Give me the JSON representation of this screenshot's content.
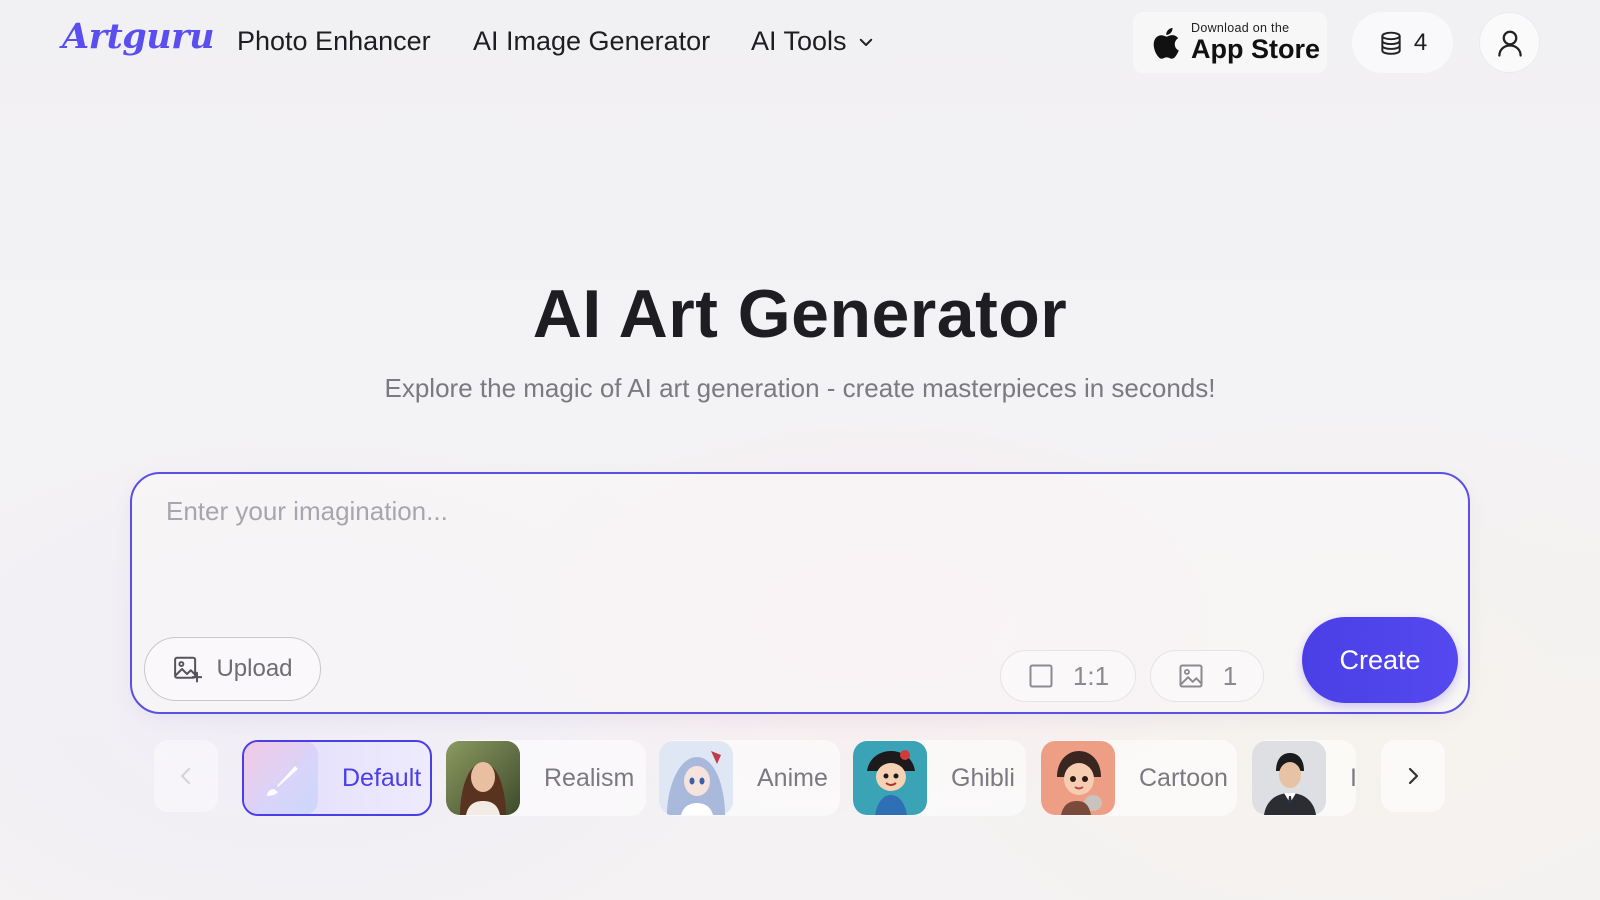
{
  "header": {
    "logo": "Artguru",
    "nav": {
      "photo_enhancer": "Photo Enhancer",
      "ai_image_generator": "AI Image Generator",
      "ai_tools": "AI Tools"
    },
    "app_store": {
      "small": "Download on the",
      "big": "App Store"
    },
    "credits": "4"
  },
  "hero": {
    "title": "AI Art Generator",
    "subtitle": "Explore the magic of AI art generation - create masterpieces in seconds!"
  },
  "prompt": {
    "placeholder": "Enter your imagination...",
    "upload_label": "Upload",
    "aspect_ratio": "1:1",
    "image_count": "1",
    "create_label": "Create"
  },
  "styles": {
    "items": [
      {
        "label": "Default",
        "selected": true
      },
      {
        "label": "Realism"
      },
      {
        "label": "Anime"
      },
      {
        "label": "Ghibli"
      },
      {
        "label": "Cartoon"
      },
      {
        "label": "I"
      }
    ]
  },
  "colors": {
    "accent": "#4a3fe6",
    "logo": "#5b4ef0"
  }
}
